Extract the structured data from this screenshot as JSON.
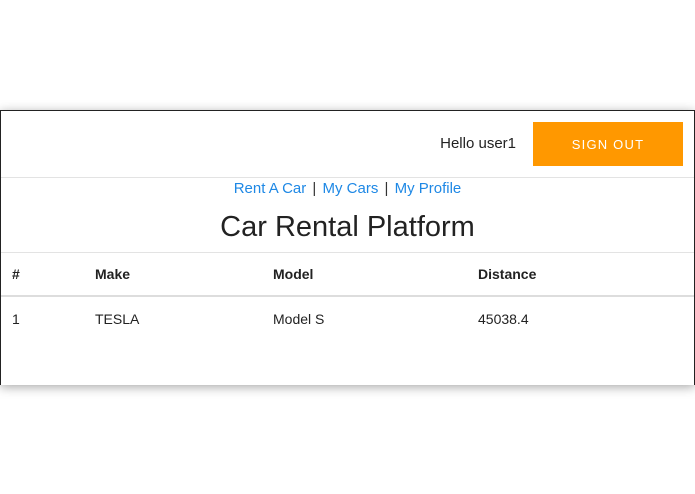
{
  "header": {
    "greeting": "Hello user1",
    "signout_label": "SIGN OUT",
    "signout_color": "#ff9800"
  },
  "nav": {
    "links": [
      "Rent A Car",
      "My Cars",
      "My Profile"
    ],
    "separator": "|",
    "link_color": "#1e88e5"
  },
  "page": {
    "title": "Car Rental Platform"
  },
  "table": {
    "columns": [
      "#",
      "Make",
      "Model",
      "Distance"
    ],
    "rows": [
      [
        "1",
        "TESLA",
        "Model S",
        "45038.4"
      ]
    ]
  }
}
